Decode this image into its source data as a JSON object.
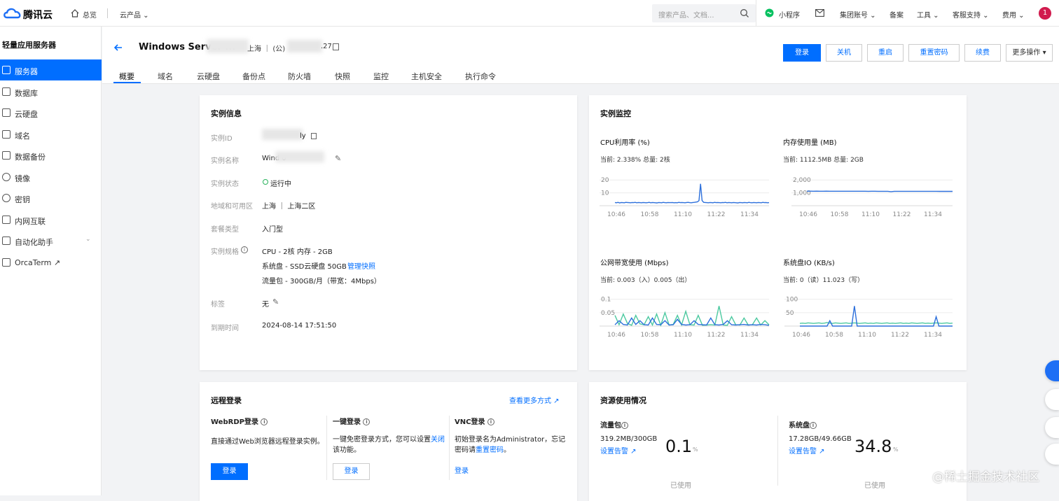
{
  "topbar": {
    "brand": "腾讯云",
    "home": "总览",
    "products": "云产品 ⌄",
    "search_placeholder": "搜索产品、文档...",
    "miniapp": "小程序",
    "links": [
      "集团账号 ⌄",
      "备案",
      "工具 ⌄",
      "客服支持 ⌄",
      "费用 ⌄"
    ],
    "avatar": "1"
  },
  "sidebar": {
    "title": "轻量应用服务器",
    "items": [
      {
        "label": "服务器",
        "icon": "cube-icon",
        "active": true
      },
      {
        "label": "数据库",
        "icon": "database-icon"
      },
      {
        "label": "云硬盘",
        "icon": "disk-icon"
      },
      {
        "label": "域名",
        "icon": "domain-icon"
      },
      {
        "label": "数据备份",
        "icon": "backup-icon"
      },
      {
        "label": "镜像",
        "icon": "image-icon"
      },
      {
        "label": "密钥",
        "icon": "key-icon"
      },
      {
        "label": "内网互联",
        "icon": "network-icon"
      },
      {
        "label": "自动化助手",
        "icon": "automation-icon"
      },
      {
        "label": "OrcaTerm ↗",
        "icon": "terminal-icon"
      }
    ]
  },
  "header": {
    "title": "Windows Server ...",
    "region": "上海 ｜ (公)",
    "ip": ".27",
    "buttons": {
      "login": "登录",
      "shutdown": "关机",
      "restart": "重启",
      "reset_password": "重置密码",
      "renew": "续费",
      "more": "更多操作 ▾"
    },
    "tabs": [
      "概要",
      "域名",
      "云硬盘",
      "备份点",
      "防火墙",
      "快照",
      "监控",
      "主机安全",
      "执行命令"
    ]
  },
  "instance_info": {
    "title": "实例信息",
    "fields": {
      "id_label": "实例ID",
      "id_value": "ly",
      "name_label": "实例名称",
      "name_value": "Wind 0",
      "status_label": "实例状态",
      "status_value": "运行中",
      "region_label": "地域和可用区",
      "region_value": "上海 ｜ 上海二区",
      "package_label": "套餐类型",
      "package_value": "入门型",
      "spec_label": "实例规格",
      "spec_line1": "CPU - 2核 内存 - 2GB",
      "spec_line2": "系统盘 - SSD云硬盘 50GB",
      "spec_link": "管理快照",
      "spec_line3": "流量包 - 300GB/月（带宽：4Mbps）",
      "tag_label": "标签",
      "tag_value": "无",
      "expire_label": "到期时间",
      "expire_value": "2024-08-14 17:51:50"
    }
  },
  "monitor": {
    "title": "实例监控",
    "colors": {
      "line": "#2c6fdb",
      "line2": "#4cc9a0"
    },
    "x_ticks": [
      "10:46",
      "10:58",
      "11:10",
      "11:22",
      "11:34"
    ]
  },
  "chart_data": [
    {
      "type": "line",
      "title": "CPU利用率 (%)",
      "current": "当前: 2.338% 总量: 2核",
      "y_ticks": [
        "20",
        "10"
      ],
      "ylim": [
        0,
        25
      ],
      "series": [
        {
          "values": [
            2.5,
            2.3,
            2.6,
            2.2,
            2.5,
            2.4,
            2.3,
            2.6,
            2.5,
            2.4,
            2.3,
            2.5,
            2.4,
            2.6,
            2.3,
            2.5,
            2.4,
            2.3,
            2.5,
            2.4,
            2.3,
            2.4,
            2.6,
            2.3,
            2.5,
            2.4,
            2.3,
            2.2,
            2.5,
            2.4,
            2.3,
            2.6,
            2.4,
            2.3,
            2.5,
            2.4,
            2.4,
            2.5,
            2.3,
            2.4,
            2.3,
            2.6,
            2.4,
            2.5,
            2.4,
            2.3,
            2.5,
            2.6,
            2.4,
            2.3,
            2.5,
            2.6,
            2.8,
            3,
            4,
            17,
            4,
            2.6,
            2.5,
            2.4,
            2.3,
            2.5,
            2.4,
            2.3,
            2.6,
            2.4,
            2.5,
            2.4,
            2.3,
            2.5,
            2.4,
            2.6,
            2.3,
            2.5,
            2.4,
            2.3,
            2.5,
            2.4,
            2.3,
            2.2,
            2.5,
            2.4,
            2.3,
            2.5,
            2.4,
            2.3,
            2.6,
            2.4,
            2.3,
            2.5,
            2.4,
            2.3,
            2.5,
            2.4,
            2.3,
            2.6,
            2.4,
            2.5,
            2.3,
            2.4
          ]
        }
      ]
    },
    {
      "type": "line",
      "title": "内存使用量 (MB)",
      "current": "当前: 1112.5MB 总量: 2GB",
      "y_ticks": [
        "2,000",
        "1,000"
      ],
      "ylim": [
        0,
        2500
      ],
      "series": [
        {
          "values": [
            1130,
            1128,
            1126,
            1129,
            1127,
            1125,
            1128,
            1126,
            1127,
            1125,
            1124,
            1126,
            1125,
            1127,
            1126,
            1124,
            1125,
            1123,
            1124,
            1122,
            1125,
            1123,
            1122,
            1121,
            1120,
            1122,
            1090,
            1118,
            1119,
            1120,
            1121,
            1122,
            1120,
            1121,
            1119,
            1120,
            1118,
            1119,
            1120,
            1121,
            1118,
            1116,
            1115,
            1114,
            1113,
            1112
          ]
        }
      ]
    },
    {
      "type": "line",
      "title": "公网带宽使用 (Mbps)",
      "current": "当前: 0.003（入）0.005（出）",
      "y_ticks": [
        "0.1",
        "0.05"
      ],
      "ylim": [
        0,
        0.12
      ],
      "series": [
        {
          "name": "入",
          "values": [
            0.005,
            0.02,
            0.006,
            0.004,
            0.03,
            0.006,
            0.02,
            0.005,
            0.004,
            0.03,
            0.006,
            0.005,
            0.02,
            0.004,
            0.005,
            0.025,
            0.006,
            0.004,
            0.005,
            0.02,
            0.006,
            0.005,
            0.004,
            0.03,
            0.005,
            0.004,
            0.006,
            0.02,
            0.005,
            0.004,
            0.005,
            0.006,
            0.004,
            0.005,
            0.004,
            0.006,
            0.005,
            0.003
          ]
        },
        {
          "name": "出",
          "values": [
            0.04,
            0.005,
            0.045,
            0.01,
            0.003,
            0.04,
            0.008,
            0.005,
            0.035,
            0.004,
            0.045,
            0.003,
            0.05,
            0.004,
            0.006,
            0.04,
            0.004,
            0.055,
            0.005,
            0.004,
            0.04,
            0.003,
            0.004,
            0.005,
            0.004,
            0.075,
            0.004,
            0.003,
            0.035,
            0.005,
            0.004,
            0.03,
            0.004,
            0.005,
            0.03,
            0.004,
            0.02,
            0.005
          ]
        }
      ]
    },
    {
      "type": "line",
      "title": "系统盘IO (KB/s)",
      "current": "当前: 0（读）11.023（写）",
      "y_ticks": [
        "100",
        "50"
      ],
      "ylim": [
        0,
        120
      ],
      "series": [
        {
          "name": "读",
          "values": [
            0,
            0,
            0,
            0,
            0,
            0,
            0,
            0,
            0,
            0,
            0,
            20,
            0,
            0,
            0,
            0,
            0,
            0,
            0,
            0,
            75,
            0,
            0,
            0,
            0,
            0,
            0,
            0,
            0,
            0,
            0,
            0,
            0,
            0,
            0,
            0,
            0,
            0,
            0,
            0,
            0,
            0,
            0,
            0,
            0,
            0,
            0,
            0,
            0,
            0,
            35,
            0,
            0,
            0,
            0,
            0,
            0
          ]
        },
        {
          "name": "写",
          "values": [
            10,
            11,
            10,
            12,
            11,
            10,
            11,
            12,
            10,
            11,
            13,
            11,
            10,
            12,
            11,
            10,
            11,
            12,
            10,
            11,
            12,
            11,
            10,
            11,
            12,
            10,
            11,
            10,
            12,
            11,
            10,
            11,
            12,
            10,
            11,
            10,
            11,
            12,
            10,
            11,
            10,
            12,
            11,
            10,
            11,
            12,
            10,
            11,
            10,
            11,
            12,
            11,
            10,
            11,
            12,
            10,
            11
          ]
        }
      ]
    }
  ],
  "remote_login": {
    "title": "远程登录",
    "more_link": "查看更多方式 ↗",
    "webrdp": {
      "title": "WebRDP登录",
      "desc": "直接通过Web浏览器远程登录实例。",
      "btn": "登录"
    },
    "oneclick": {
      "title": "一键登录",
      "desc1": "一键免密登录方式，您可以设置",
      "link": "关闭",
      "desc2": "该功能。",
      "btn": "登录"
    },
    "vnc": {
      "title": "VNC登录",
      "desc1": "初始登录名为Administrator，忘记",
      "desc2": "密码请",
      "link": "重置密码",
      "desc3": "。",
      "btn": "登录"
    }
  },
  "resources": {
    "title": "资源使用情况",
    "traffic": {
      "title": "流量包",
      "usage": "319.2MB/300GB",
      "alert": "设置告警 ↗",
      "percent": "0.1",
      "percent_value": 0.1,
      "used": "已使用"
    },
    "disk": {
      "title": "系统盘",
      "usage": "17.28GB/49.66GB",
      "alert": "设置告警 ↗",
      "percent": "34.8",
      "percent_value": 34.8,
      "used": "已使用"
    },
    "unit": "%"
  },
  "watermark": "@稀土掘金技术社区"
}
